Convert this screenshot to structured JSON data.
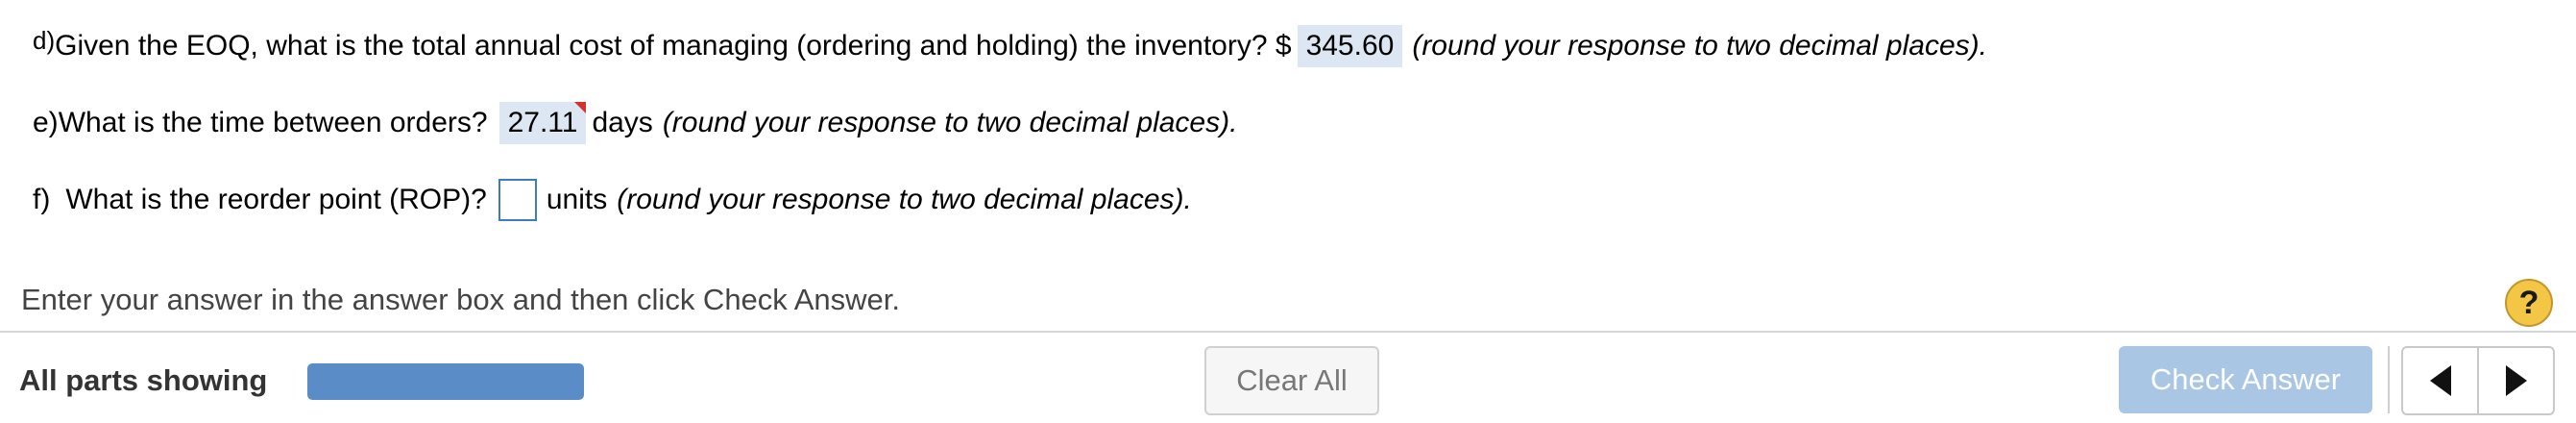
{
  "questions": {
    "d": {
      "label": "d)",
      "text": "Given the EOQ, what is the total annual cost of managing (ordering and holding) the inventory? $",
      "answer": "345.60",
      "hint": "(round your response to two decimal places)."
    },
    "e": {
      "label": "e)",
      "text": "What is the time between orders?",
      "answer": "27.11",
      "unit": "days",
      "hint": "(round your response to two decimal places)."
    },
    "f": {
      "label": "f)",
      "text": "What is the reorder point (ROP)?",
      "answer": "",
      "unit": "units",
      "hint": "(round your response to two decimal places)."
    }
  },
  "instruction": "Enter your answer in the answer box and then click Check Answer.",
  "help_icon": "?",
  "footer": {
    "all_parts_label": "All parts showing",
    "progress": 1.0,
    "clear_all": "Clear All",
    "check_answer": "Check Answer"
  },
  "colors": {
    "answer_bg": "#dde6f3",
    "progress_fill": "#5a8cc8",
    "check_button": "#a9c7e5",
    "help_icon": "#f3c646",
    "flag": "#d0342c"
  },
  "icons": [
    "question-mark-icon",
    "previous-arrow-icon",
    "next-arrow-icon",
    "incorrect-flag-icon"
  ]
}
